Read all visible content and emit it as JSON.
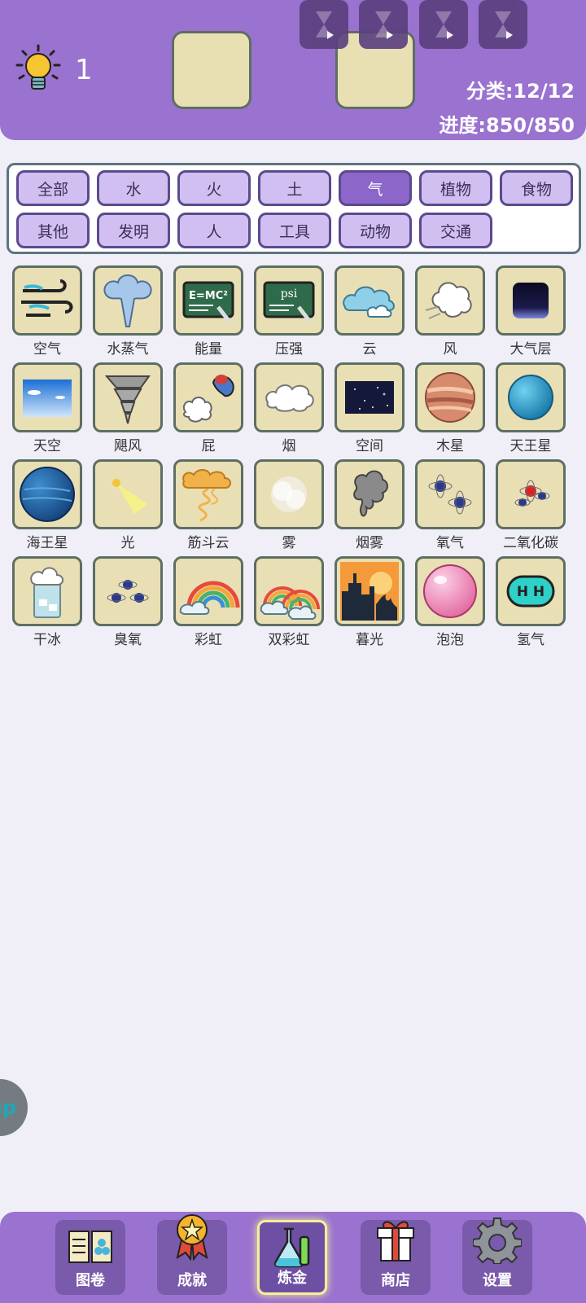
{
  "header": {
    "hint_count": "1",
    "category_stat": "分类:12/12",
    "progress_stat": "进度:850/850",
    "timers": [
      "hourglass-play",
      "hourglass-play",
      "hourglass-play",
      "hourglass-play"
    ]
  },
  "filters": {
    "active": "气",
    "tabs": [
      "全部",
      "水",
      "火",
      "土",
      "气",
      "植物",
      "食物",
      "其他",
      "发明",
      "人",
      "工具",
      "动物",
      "交通"
    ]
  },
  "elements": [
    {
      "label": "空气",
      "icon": "wind-icon"
    },
    {
      "label": "水蒸气",
      "icon": "steam-cloud-icon"
    },
    {
      "label": "能量",
      "icon": "emc2-board-icon"
    },
    {
      "label": "压强",
      "icon": "psi-board-icon"
    },
    {
      "label": "云",
      "icon": "cloud-icon"
    },
    {
      "label": "风",
      "icon": "gust-icon"
    },
    {
      "label": "大气层",
      "icon": "atmosphere-icon"
    },
    {
      "label": "天空",
      "icon": "sky-icon"
    },
    {
      "label": "飓风",
      "icon": "tornado-icon"
    },
    {
      "label": "屁",
      "icon": "fart-icon"
    },
    {
      "label": "烟",
      "icon": "smoke-icon"
    },
    {
      "label": "空间",
      "icon": "space-icon"
    },
    {
      "label": "木星",
      "icon": "jupiter-icon"
    },
    {
      "label": "天王星",
      "icon": "uranus-icon"
    },
    {
      "label": "海王星",
      "icon": "neptune-icon"
    },
    {
      "label": "光",
      "icon": "light-beam-icon"
    },
    {
      "label": "筋斗云",
      "icon": "magic-cloud-icon"
    },
    {
      "label": "雾",
      "icon": "fog-icon"
    },
    {
      "label": "烟雾",
      "icon": "smog-icon"
    },
    {
      "label": "氧气",
      "icon": "oxygen-icon"
    },
    {
      "label": "二氧化碳",
      "icon": "co2-icon"
    },
    {
      "label": "干冰",
      "icon": "dry-ice-icon"
    },
    {
      "label": "臭氧",
      "icon": "ozone-icon"
    },
    {
      "label": "彩虹",
      "icon": "rainbow-icon"
    },
    {
      "label": "双彩虹",
      "icon": "double-rainbow-icon"
    },
    {
      "label": "暮光",
      "icon": "twilight-icon"
    },
    {
      "label": "泡泡",
      "icon": "bubble-icon"
    },
    {
      "label": "氢气",
      "icon": "hydrogen-icon"
    }
  ],
  "side_bubble": "up",
  "bottom_nav": [
    {
      "label": "图卷",
      "icon": "book-icon"
    },
    {
      "label": "成就",
      "icon": "medal-icon"
    },
    {
      "label": "炼金",
      "icon": "flask-icon",
      "active": true
    },
    {
      "label": "商店",
      "icon": "gift-icon"
    },
    {
      "label": "设置",
      "icon": "gear-icon"
    }
  ],
  "colors": {
    "header": "#9a72cf",
    "tab": "#d2bff2",
    "tab_active": "#8c66c9",
    "tile": "#e9dfb4",
    "tile_border": "#5d6f63"
  }
}
